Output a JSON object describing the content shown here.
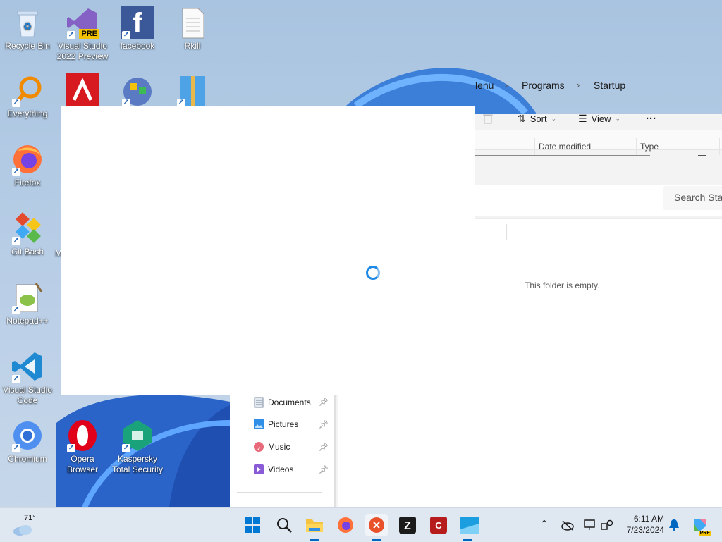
{
  "desktop": {
    "icons": [
      {
        "label": "Recycle Bin"
      },
      {
        "label": "Visual Studio 2022 Preview",
        "badge": "PRE"
      },
      {
        "label": "facebook",
        "glyph": "f"
      },
      {
        "label": "Rkill"
      },
      {
        "label": "Everything"
      },
      {
        "label": "Firefox"
      },
      {
        "label": "Git Bash"
      },
      {
        "label": "Notepad++"
      },
      {
        "label": "Visual Studio Code"
      },
      {
        "label": "Chromium"
      },
      {
        "label": "Opera Browser"
      },
      {
        "label": "Kaspersky Total Security"
      }
    ],
    "partial_label": "M"
  },
  "explorer": {
    "breadcrumbs": [
      "Start Menu",
      "Programs",
      "Startup"
    ],
    "breadcrumb_partial": "lenu",
    "search_placeholder": "Search Star",
    "toolbar": {
      "sort": "Sort",
      "view": "View",
      "more": "···"
    },
    "columns": [
      "Date modified",
      "Type"
    ],
    "empty_message": "This folder is empty.",
    "nav_items": [
      {
        "label": "Documents"
      },
      {
        "label": "Pictures"
      },
      {
        "label": "Music"
      },
      {
        "label": "Videos"
      }
    ]
  },
  "taskbar": {
    "weather": "71°",
    "time": "6:11 AM",
    "date": "7/23/2024",
    "copilot_badge": "PRE"
  },
  "colors": {
    "accent": "#0067c0",
    "spinner": "#1e88e5"
  }
}
